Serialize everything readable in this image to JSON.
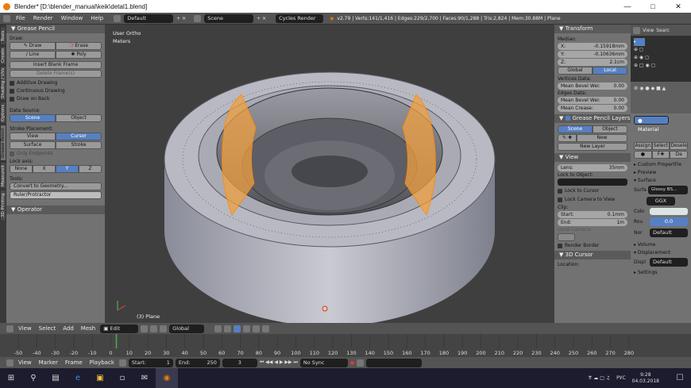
{
  "window": {
    "title": "Blender* [D:\\blender_manual\\keik\\detal1.blend]"
  },
  "info_bar": {
    "menus": [
      "File",
      "Render",
      "Window",
      "Help"
    ],
    "layout": "Default",
    "scene": "Scene",
    "engine": "Cycles Render",
    "stats": "v2.79 | Verts:141/1,416 | Edges:229/2,700 | Faces:90/1,288 | Tris:2,824 | Mem:30.88M | Plane"
  },
  "tool_tabs": [
    "Tools",
    "Create",
    "Shading / UVs",
    "Options",
    "Grease Pencil",
    "Measureit",
    "3D Printing"
  ],
  "grease_pencil": {
    "header": "Grease Pencil",
    "draw_label": "Draw:",
    "draw": "Draw",
    "erase": "Erase",
    "line": "Line",
    "poly": "Poly",
    "insert_blank": "Insert Blank Frame",
    "delete_frames": "Delete Frame(s)",
    "additive": "Additive Drawing",
    "continuous": "Continuous Drawing",
    "draw_on_back": "Draw on Back",
    "data_source_label": "Data Source:",
    "scene_btn": "Scene",
    "object_btn": "Object",
    "stroke_placement_label": "Stroke Placement:",
    "view_btn": "View",
    "cursor_btn": "Cursor",
    "surface_btn": "Surface",
    "stroke_btn": "Stroke",
    "only_endpoints": "Only Endpoints",
    "lock_axis_label": "Lock axis:",
    "axes": [
      "None",
      "X",
      "Y",
      "Z"
    ],
    "tools_label": "Tools:",
    "convert": "Convert to Geometry...",
    "ruler": "Ruler/Protractor"
  },
  "operator": {
    "header": "Operator"
  },
  "viewport": {
    "view_name": "User Ortho",
    "units": "Meters",
    "object_label": "(3) Plane"
  },
  "transform": {
    "header": "Transform",
    "median_label": "Median:",
    "x_label": "X:",
    "x": "-0.15918mm",
    "y_label": "Y:",
    "y": "-0.10636mm",
    "z_label": "Z:",
    "z": "2.1cm",
    "global": "Global",
    "local": "Local",
    "vertices_data": "Vertices Data:",
    "mean_bevel_v": "Mean Bevel Wei:",
    "mean_bevel_v_val": "0.00",
    "edges_data": "Edges Data:",
    "mean_bevel_e": "Mean Bevel Wei:",
    "mean_bevel_e_val": "0.00",
    "mean_crease": "Mean Crease:",
    "mean_crease_val": "0.00"
  },
  "gp_layers": {
    "header": "Grease Pencil Layers",
    "scene": "Scene",
    "object": "Object",
    "new": "New",
    "new_layer": "New Layer"
  },
  "view_panel": {
    "header": "View",
    "lens_label": "Lens:",
    "lens": "35mm",
    "lock_object": "Lock to Object:",
    "lock_cursor": "Lock to Cursor",
    "lock_camera": "Lock Camera to View",
    "clip_label": "Clip:",
    "start_label": "Start:",
    "start": "0.1mm",
    "end_label": "End:",
    "end": "1m",
    "local_camera": "Local Camera:",
    "render_border": "Render Border"
  },
  "cursor_panel": {
    "header": "3D Cursor",
    "location": "Location:"
  },
  "outliner": {
    "view": "View",
    "search": "Searc"
  },
  "properties": {
    "material": "Material",
    "assign": "Assign",
    "select": "Select",
    "deselect": "Desele",
    "da": "Da",
    "custom_props": "Custom PropertFie",
    "preview": "Preview",
    "surface": "Surface",
    "surf_label": "Surfa",
    "surf_val": "Glossy BS...",
    "ggx": "GGX",
    "color_label": "Colo",
    "rough_label": "Rou",
    "rough_val": "0.0",
    "normal_label": "Nor",
    "normal_val": "Default",
    "volume": "Volume",
    "displacement": "Displacement",
    "displ_label": "Displ",
    "displ_val": "Default",
    "settings": "Settings"
  },
  "view3d_header": {
    "menus": [
      "View",
      "Select",
      "Add",
      "Mesh"
    ],
    "mode": "Edit Mode",
    "orientation": "Global"
  },
  "timeline": {
    "ticks": [
      "-50",
      "-40",
      "-30",
      "-20",
      "-10",
      "0",
      "10",
      "20",
      "30",
      "40",
      "50",
      "60",
      "70",
      "80",
      "90",
      "100",
      "110",
      "120",
      "130",
      "140",
      "150",
      "160",
      "170",
      "180",
      "190",
      "200",
      "210",
      "220",
      "230",
      "240",
      "250",
      "260",
      "270",
      "280"
    ],
    "current_frame_value": 3
  },
  "timeline_header": {
    "menus": [
      "View",
      "Marker",
      "Frame",
      "Playback"
    ],
    "start_label": "Start:",
    "start": "1",
    "end_label": "End:",
    "end": "250",
    "current": "3",
    "sync": "No Sync"
  },
  "taskbar": {
    "lang": "РУС",
    "time": "9:28",
    "date": "04.03.2018"
  },
  "colors": {
    "accent": "#5680c2",
    "selection": "#f0a040",
    "panel": "#727272",
    "viewport": "#3f3f3f"
  }
}
